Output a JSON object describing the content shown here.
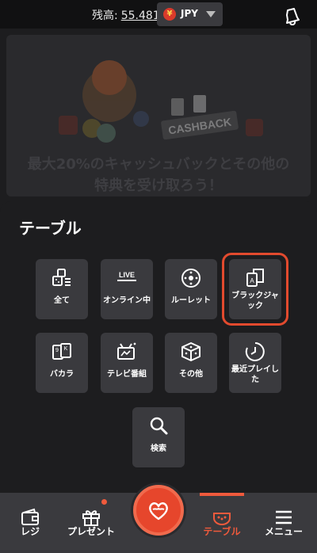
{
  "header": {
    "balance_label": "残高:",
    "balance_value": "55.481",
    "currency_symbol": "¥",
    "currency_code": "JPY"
  },
  "banner": {
    "badge": "CASHBACK",
    "line1": "最大20%のキャッシュバックとその他の",
    "line2": "特典を受け取ろう！"
  },
  "section_title": "テーブル",
  "tiles": [
    {
      "label": "全て",
      "icon": "all-games-icon"
    },
    {
      "label": "オンライン中",
      "icon": "live-icon",
      "badge": "LIVE"
    },
    {
      "label": "ルーレット",
      "icon": "roulette-icon"
    },
    {
      "label": "ブラックジャック",
      "icon": "blackjack-cards-icon",
      "selected": true
    },
    {
      "label": "バカラ",
      "icon": "baccarat-cards-icon",
      "cards": "9 K"
    },
    {
      "label": "テレビ番組",
      "icon": "tv-show-icon"
    },
    {
      "label": "その他",
      "icon": "dice-icon"
    },
    {
      "label": "最近プレイした",
      "icon": "recent-clock-icon"
    },
    {
      "label": "検索",
      "icon": "search-icon"
    }
  ],
  "bottom_nav": [
    {
      "label": "レジ",
      "icon": "wallet-icon"
    },
    {
      "label": "プレゼント",
      "icon": "gift-icon"
    },
    {
      "label": "",
      "icon": "home-logo-icon"
    },
    {
      "label": "テーブル",
      "icon": "table-icon",
      "active": true
    },
    {
      "label": "メニュー",
      "icon": "menu-icon"
    }
  ],
  "colors": {
    "accent": "#e6462c",
    "background": "#1d1d1f",
    "tile": "#3a3a3e"
  }
}
